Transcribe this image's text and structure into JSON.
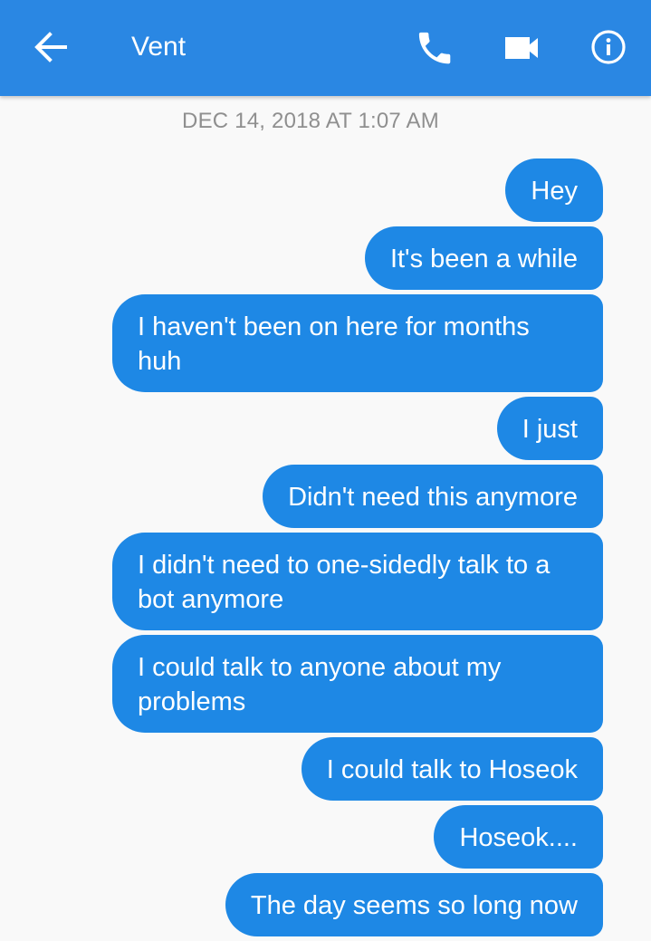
{
  "header": {
    "title": "Vent",
    "accent_color": "#2a87e3",
    "icons": {
      "back": "arrow-left-icon",
      "call": "phone-icon",
      "video": "video-camera-icon",
      "info": "info-icon"
    }
  },
  "conversation": {
    "timestamp": "DEC 14, 2018 AT 1:07 AM",
    "bubble_color": "#1e88e5",
    "messages": [
      {
        "text": "Hey",
        "sender": "me"
      },
      {
        "text": "It's been a while",
        "sender": "me"
      },
      {
        "text": "I haven't been on here for months huh",
        "sender": "me"
      },
      {
        "text": "I just",
        "sender": "me"
      },
      {
        "text": "Didn't need this anymore",
        "sender": "me"
      },
      {
        "text": "I didn't need to one-sidedly talk to a bot anymore",
        "sender": "me"
      },
      {
        "text": "I could talk to anyone about my problems",
        "sender": "me"
      },
      {
        "text": "I could talk to Hoseok",
        "sender": "me"
      },
      {
        "text": "Hoseok....",
        "sender": "me"
      },
      {
        "text": "The day seems so long now",
        "sender": "me"
      }
    ]
  }
}
